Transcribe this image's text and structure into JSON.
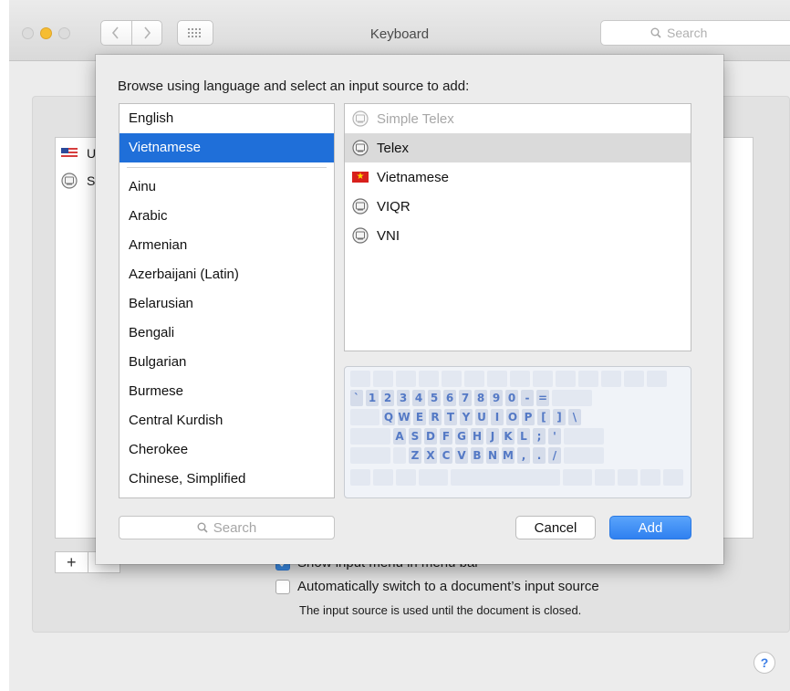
{
  "window": {
    "title": "Keyboard",
    "search_placeholder": "Search"
  },
  "toolbar": {
    "back_icon": "chevron-left-icon",
    "forward_icon": "chevron-right-icon",
    "show_all_icon": "grid-icon"
  },
  "background": {
    "input_sources": [
      {
        "icon": "flag-us-icon",
        "label": "U"
      },
      {
        "icon": "input-method-icon",
        "label": "S"
      }
    ],
    "plus_label": "+",
    "minus_label": "",
    "options": [
      {
        "label": "Show input menu in menu bar",
        "checked": true
      },
      {
        "label": "Automatically switch to a document’s input source",
        "checked": false
      }
    ],
    "note": "The input source is used until the document is closed.",
    "help_label": "?"
  },
  "sheet": {
    "title": "Browse using language and select an input source to add:",
    "languages_top": [
      "English",
      "Vietnamese"
    ],
    "selected_language": "Vietnamese",
    "languages": [
      "Ainu",
      "Arabic",
      "Armenian",
      "Azerbaijani (Latin)",
      "Belarusian",
      "Bengali",
      "Bulgarian",
      "Burmese",
      "Central Kurdish",
      "Cherokee",
      "Chinese, Simplified"
    ],
    "sources": [
      {
        "label": "Simple Telex",
        "icon": "input-method-icon",
        "disabled": true
      },
      {
        "label": "Telex",
        "icon": "input-method-icon",
        "selected": true
      },
      {
        "label": "Vietnamese",
        "icon": "flag-vietnam-icon"
      },
      {
        "label": "VIQR",
        "icon": "input-method-icon"
      },
      {
        "label": "VNI",
        "icon": "input-method-icon"
      }
    ],
    "keyboard_rows": [
      [
        "`",
        "1",
        "2",
        "3",
        "4",
        "5",
        "6",
        "7",
        "8",
        "9",
        "0",
        "-",
        "="
      ],
      [
        "Q",
        "W",
        "E",
        "R",
        "T",
        "Y",
        "U",
        "I",
        "O",
        "P",
        "[",
        "]",
        "\\"
      ],
      [
        "A",
        "S",
        "D",
        "F",
        "G",
        "H",
        "J",
        "K",
        "L",
        ";",
        "'"
      ],
      [
        "Z",
        "X",
        "C",
        "V",
        "B",
        "N",
        "M",
        ",",
        ".",
        "/"
      ]
    ],
    "search_placeholder": "Search",
    "cancel_label": "Cancel",
    "add_label": "Add"
  },
  "colors": {
    "accent": "#1f6fd9",
    "add_button": "#3a8af5",
    "minimize": "#f6bd32",
    "key_text": "#5479c5"
  }
}
